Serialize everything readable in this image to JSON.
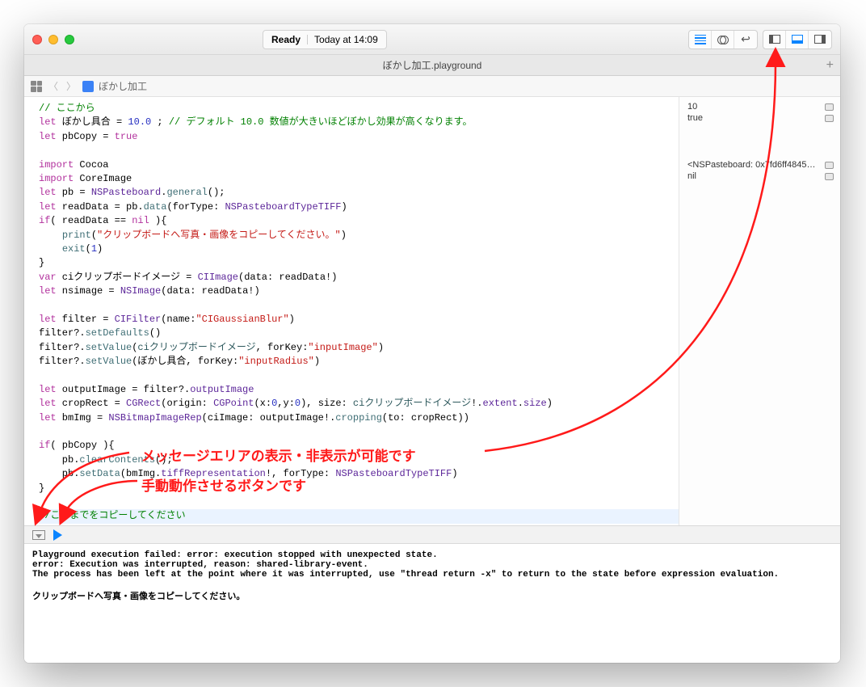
{
  "status": {
    "state": "Ready",
    "time": "Today at 14:09"
  },
  "tab": {
    "title": "ぼかし加工.playground"
  },
  "jump": {
    "name": "ぼかし加工"
  },
  "side": {
    "v1": "10",
    "v2": "true",
    "v3": "<NSPasteboard: 0x7fd6ff48452...",
    "v4": "nil"
  },
  "code": {
    "l1a": "// ここから",
    "l2a": "let",
    "l2b": " ぼかし具合 = ",
    "l2c": "10.0",
    "l2d": " ; ",
    "l2e": "// デフォルト 10.0 数値が大きいほどぼかし効果が高くなります。",
    "l3a": "let",
    "l3b": " pbCopy = ",
    "l3c": "true",
    "l5a": "import",
    "l5b": " Cocoa",
    "l6a": "import",
    "l6b": " CoreImage",
    "l7a": "let",
    "l7b": " pb = ",
    "l7c": "NSPasteboard",
    "l7d": ".",
    "l7e": "general",
    "l7f": "();",
    "l8a": "let",
    "l8b": " readData = pb.",
    "l8c": "data",
    "l8d": "(forType: ",
    "l8e": "NSPasteboardTypeTIFF",
    "l8f": ")",
    "l9a": "if",
    "l9b": "( readData == ",
    "l9c": "nil",
    "l9d": " ){",
    "l10a": "    ",
    "l10b": "print",
    "l10c": "(",
    "l10d": "\"クリップボードへ写真・画像をコピーしてください。\"",
    "l10e": ")",
    "l11a": "    ",
    "l11b": "exit",
    "l11c": "(",
    "l11d": "1",
    "l11e": ")",
    "l12a": "}",
    "l13a": "var",
    "l13b": " ciクリップボードイメージ = ",
    "l13c": "CIImage",
    "l13d": "(data: readData!)",
    "l14a": "let",
    "l14b": " nsimage = ",
    "l14c": "NSImage",
    "l14d": "(data: readData!)",
    "l16a": "let",
    "l16b": " filter = ",
    "l16c": "CIFilter",
    "l16d": "(name:",
    "l16e": "\"CIGaussianBlur\"",
    "l16f": ")",
    "l17a": "filter?.",
    "l17b": "setDefaults",
    "l17c": "()",
    "l18a": "filter?.",
    "l18b": "setValue",
    "l18c": "(",
    "l18d": "ciクリップボードイメージ",
    "l18e": ", forKey:",
    "l18f": "\"inputImage\"",
    "l18g": ")",
    "l19a": "filter?.",
    "l19b": "setValue",
    "l19c": "(ぼかし具合, forKey:",
    "l19d": "\"inputRadius\"",
    "l19e": ")",
    "l21a": "let",
    "l21b": " outputImage = filter?.",
    "l21c": "outputImage",
    "l22a": "let",
    "l22b": " cropRect = ",
    "l22c": "CGRect",
    "l22d": "(origin: ",
    "l22e": "CGPoint",
    "l22f": "(x:",
    "l22g": "0",
    "l22h": ",y:",
    "l22i": "0",
    "l22j": "), size: ",
    "l22k": "ciクリップボードイメージ",
    "l22l": "!.",
    "l22m": "extent",
    "l22n": ".",
    "l22o": "size",
    "l22p": ")",
    "l23a": "let",
    "l23b": " bmImg = ",
    "l23c": "NSBitmapImageRep",
    "l23d": "(ciImage: outputImage!.",
    "l23e": "cropping",
    "l23f": "(to: cropRect))",
    "l25a": "if",
    "l25b": "( pbCopy ){",
    "l26a": "    pb.",
    "l26b": "clearContents",
    "l26c": "();",
    "l27a": "    pb.",
    "l27b": "setData",
    "l27c": "(bmImg.",
    "l27d": "tiffRepresentation",
    "l27e": "!, forType: ",
    "l27f": "NSPasteboardTypeTIFF",
    "l27g": ")",
    "l28a": "}",
    "l30a": "//ここまでをコピーしてください"
  },
  "console": {
    "l1": "Playground execution failed: error: execution stopped with unexpected state.",
    "l2": "error: Execution was interrupted, reason: shared-library-event.",
    "l3": "The process has been left at the point where it was interrupted, use \"thread return -x\" to return to the state before expression evaluation.",
    "l5": "クリップボードへ写真・画像をコピーしてください。"
  },
  "anno": {
    "a1": "メッセージエリアの表示・非表示が可能です",
    "a2": "手動動作させるボタンです"
  }
}
